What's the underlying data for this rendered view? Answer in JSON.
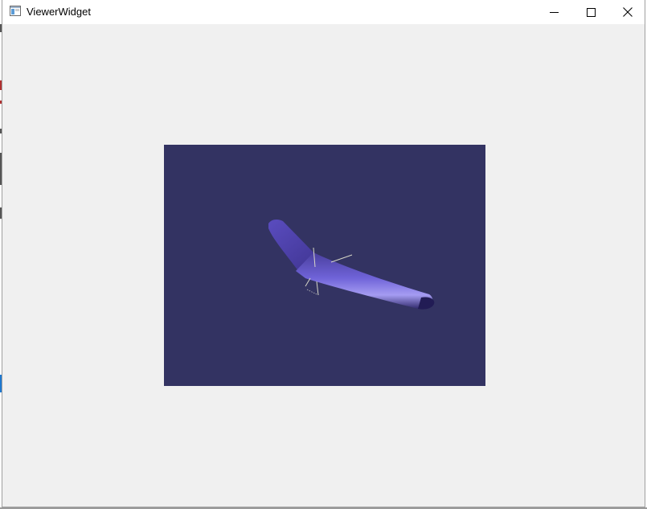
{
  "window": {
    "title": "ViewerWidget",
    "controls": {
      "minimize_icon": "minimize-icon",
      "maximize_icon": "maximize-icon",
      "close_icon": "close-icon"
    }
  },
  "viewer": {
    "background_color": "#333362",
    "model": "flying-wing-aircraft",
    "model_color": "#6e63d6"
  },
  "colors": {
    "window_bg": "#f0f0f0",
    "titlebar_bg": "#ffffff"
  }
}
